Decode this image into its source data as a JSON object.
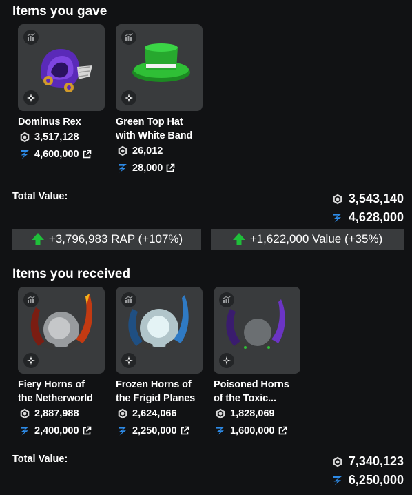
{
  "gave": {
    "title": "Items you gave",
    "items": [
      {
        "name_lines": [
          "Dominus Rex"
        ],
        "rap": "3,517,128",
        "value": "4,600,000",
        "icon": "dominus-rex-icon"
      },
      {
        "name_lines": [
          "Green Top Hat",
          "with White Band"
        ],
        "rap": "26,012",
        "value": "28,000",
        "icon": "green-top-hat-icon"
      }
    ],
    "total_label": "Total Value:",
    "total_rap": "3,543,140",
    "total_value": "4,628,000"
  },
  "gains": {
    "rap": "+3,796,983 RAP (+107%)",
    "value": "+1,622,000 Value (+35%)"
  },
  "received": {
    "title": "Items you received",
    "items": [
      {
        "name_lines": [
          "Fiery Horns of",
          "the Netherworld"
        ],
        "rap": "2,887,988",
        "value": "2,400,000",
        "icon": "fiery-horns-icon"
      },
      {
        "name_lines": [
          "Frozen Horns of",
          "the Frigid Planes"
        ],
        "rap": "2,624,066",
        "value": "2,250,000",
        "icon": "frozen-horns-icon"
      },
      {
        "name_lines": [
          "Poisoned Horns",
          "of the Toxic..."
        ],
        "rap": "1,828,069",
        "value": "1,600,000",
        "icon": "poisoned-horns-icon"
      }
    ],
    "total_label": "Total Value:",
    "total_rap": "7,340,123",
    "total_value": "6,250,000"
  },
  "colors": {
    "background": "#111214",
    "card": "#393b3d",
    "value_blue": "#2d8ae6",
    "gain_green": "#1fbf3a"
  }
}
